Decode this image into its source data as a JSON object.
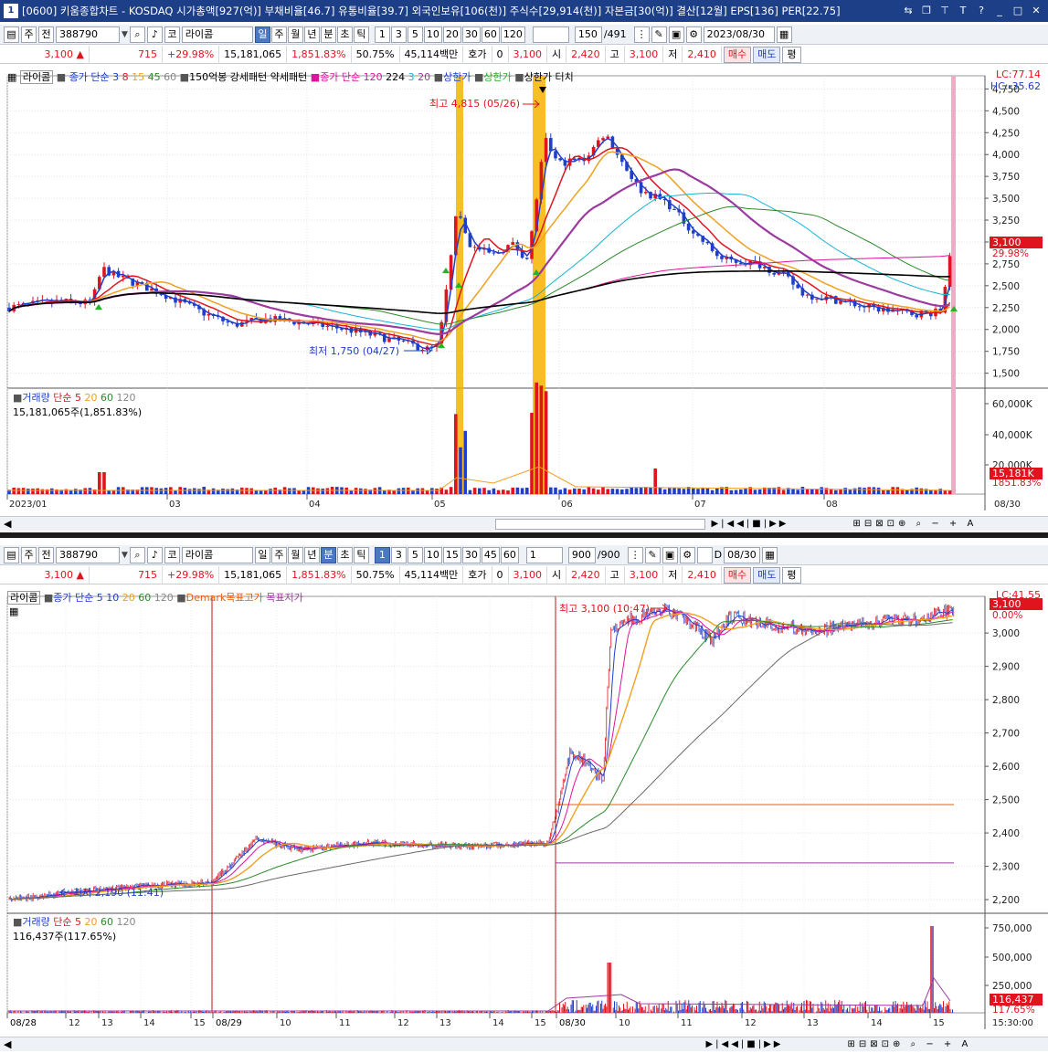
{
  "title": {
    "num": "1",
    "text": "[0600] 키움종합차트 - KOSDAQ 시가총액[927(억)] 부채비율[46.7] 유통비율[39.7] 외국인보유[106(천)] 주식수[29,914(천)] 자본금[30(억)] 결산[12월] EPS[136] PER[22.75]"
  },
  "colors": {
    "up": "#e0141e",
    "down": "#1f3fc8",
    "ma3": "#1f3fc8",
    "ma8": "#e0141e",
    "ma15": "#f0a020",
    "ma45": "#2a8a2a",
    "ma60": "#9c3aa0",
    "ma120": "#6a6a6a",
    "highlight": "#f5b400",
    "pink": "#f6a9c7"
  },
  "top": {
    "toolbar": {
      "type": "주",
      "prev": "전",
      "code": "388790",
      "market": "코",
      "name": "라이콤",
      "periods": [
        "일",
        "주",
        "월",
        "년",
        "분",
        "초",
        "틱"
      ],
      "selected_period": "일",
      "nums": [
        "1",
        "3",
        "5",
        "10",
        "20",
        "30",
        "60",
        "120"
      ],
      "count": "150",
      "total": "/491",
      "date": "2023/08/30"
    },
    "quote": {
      "price": "3,100",
      "change": "715",
      "pct": "+29.98%",
      "volume": "15,181,065",
      "volume_pct": "1,851.83%",
      "ratio": "50.75%",
      "amount": "45,114백만",
      "hoga_label": "호가",
      "hoga": "0",
      "hoga_price": "3,100",
      "open_label": "시",
      "open": "2,420",
      "high_label": "고",
      "high": "3,100",
      "low_label": "저",
      "low": "2,410",
      "buy": "매수",
      "sell": "매도",
      "flat": "평"
    },
    "legend": {
      "name": "라이콤",
      "ma_label": "종가 단순",
      "ma": [
        "3",
        "8",
        "15",
        "45",
        "60"
      ],
      "extra1": "150억봉 강세패턴",
      "extra2": "약세패턴",
      "ma2_label": "종가 단순",
      "ma2": "120",
      "n224": "224",
      "n3": "3",
      "n20": "20",
      "upper": "상한가",
      "upper2": "상한가",
      "upper_touch": "상한가 터치"
    },
    "lc": "LC:77.14",
    "hc": "HC:-35.62",
    "high_ann": "최고 4,815 (05/26)",
    "low_ann": "최저 1,750 (04/27)",
    "yticks": [
      "4,750",
      "4,500",
      "4,250",
      "4,000",
      "3,750",
      "3,500",
      "3,250",
      "3,000",
      "2,750",
      "2,500",
      "2,250",
      "2,000",
      "1,750",
      "1,500"
    ],
    "price_tag": "3,100",
    "pct_tag": "29.98%",
    "vol_legend": {
      "label": "거래량",
      "ma_label": "단순",
      "ma": [
        "5",
        "20",
        "60",
        "120"
      ],
      "value": "15,181,065주(1,851.83%)"
    },
    "vol_ticks": [
      "60,000K",
      "40,000K",
      "20,000K"
    ],
    "vol_tag": "15,181K",
    "vol_pct_tag": "1851.83%",
    "xticks": [
      "2023/01",
      "03",
      "04",
      "05",
      "06",
      "07",
      "08"
    ],
    "xend": "08/30"
  },
  "bottom": {
    "toolbar": {
      "type": "주",
      "prev": "전",
      "code": "388790",
      "market": "코",
      "name": "라이콤",
      "periods": [
        "일",
        "주",
        "월",
        "년",
        "분",
        "초",
        "틱"
      ],
      "selected_period": "분",
      "nums": [
        "1",
        "3",
        "5",
        "10",
        "15",
        "30",
        "45",
        "60"
      ],
      "interval": "1",
      "count": "900",
      "total": "/900",
      "date_label": "D",
      "date": "08/30"
    },
    "quote": {
      "price": "3,100",
      "change": "715",
      "pct": "+29.98%",
      "volume": "15,181,065",
      "volume_pct": "1,851.83%",
      "ratio": "50.75%",
      "amount": "45,114백만",
      "hoga_label": "호가",
      "hoga": "0",
      "hoga_price": "3,100",
      "open_label": "시",
      "open": "2,420",
      "high_label": "고",
      "high": "3,100",
      "low_label": "저",
      "low": "2,410",
      "buy": "매수",
      "sell": "매도",
      "flat": "평"
    },
    "legend": {
      "name": "라이콤",
      "ma_label": "종가 단순",
      "ma": [
        "5",
        "10",
        "20",
        "60",
        "120"
      ],
      "demark_hi": "Demark목표고가",
      "demark_lo": "목표저가"
    },
    "lc": "LC:41.55",
    "price_tag": "3,100",
    "pct_tag": "0.00%",
    "high_ann": "최고 3,100 (10:47)",
    "low_ann": "최저 2,190 (11:41)",
    "yticks": [
      "3,000",
      "2,900",
      "2,800",
      "2,700",
      "2,600",
      "2,500",
      "2,400",
      "2,300",
      "2,200"
    ],
    "vol_legend": {
      "label": "거래량",
      "ma_label": "단순",
      "ma": [
        "5",
        "20",
        "60",
        "120"
      ],
      "value": "116,437주(117.65%)"
    },
    "vol_ticks": [
      "750,000",
      "500,000",
      "250,000"
    ],
    "vol_tag": "116,437",
    "vol_pct_tag": "117.65%",
    "xticks": [
      "08/28",
      "12",
      "13",
      "14",
      "15",
      "08/29",
      "10",
      "11",
      "12",
      "13",
      "14",
      "15",
      "08/30",
      "10",
      "11",
      "12",
      "13",
      "14",
      "15"
    ],
    "xend": "15:30:00"
  },
  "chart_data": [
    {
      "type": "candlestick",
      "title": "라이콤 일봉",
      "x_range": [
        "2023/01",
        "2023/08/30"
      ],
      "ylim": [
        1500,
        4815
      ],
      "series": [
        {
          "name": "종가 단순 3"
        },
        {
          "name": "8"
        },
        {
          "name": "15"
        },
        {
          "name": "45"
        },
        {
          "name": "60"
        },
        {
          "name": "120"
        }
      ],
      "annotations": [
        "최고 4,815 (05/26)",
        "최저 1,750 (04/27)"
      ],
      "last_close": 3100
    },
    {
      "type": "candlestick",
      "title": "라이콤 분봉",
      "x_range": [
        "08/28",
        "08/30 15:30"
      ],
      "ylim": [
        2190,
        3100
      ],
      "annotations": [
        "최고 3,100 (10:47)",
        "최저 2,190 (11:41)"
      ],
      "last_close": 3100
    }
  ]
}
